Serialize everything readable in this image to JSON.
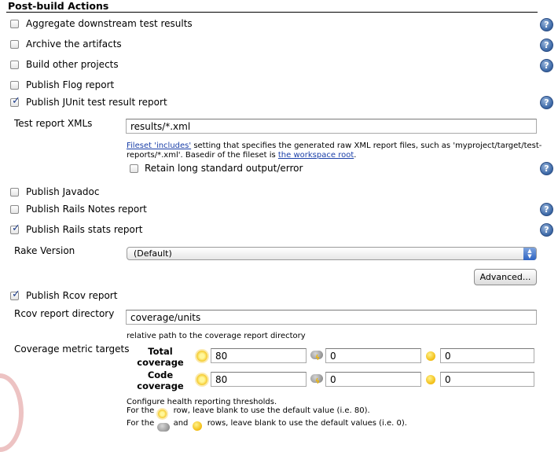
{
  "section": {
    "title": "Post-build Actions"
  },
  "actions": {
    "aggregate": {
      "label": "Aggregate downstream test results",
      "checked": false
    },
    "archive": {
      "label": "Archive the artifacts",
      "checked": false
    },
    "build_other": {
      "label": "Build other projects",
      "checked": false
    },
    "flog": {
      "label": "Publish Flog report",
      "checked": false
    },
    "junit": {
      "label": "Publish JUnit test result report",
      "checked": true
    },
    "javadoc": {
      "label": "Publish Javadoc",
      "checked": false
    },
    "rails_notes": {
      "label": "Publish Rails Notes report",
      "checked": false
    },
    "rails_stats": {
      "label": "Publish Rails stats report",
      "checked": true
    },
    "rcov": {
      "label": "Publish Rcov report",
      "checked": true
    }
  },
  "junit": {
    "xml_label": "Test report XMLs",
    "xml_value": "results/*.xml",
    "fileset_link": "Fileset 'includes'",
    "desc_part1": " setting that specifies the generated raw XML report files, such as 'myproject/target/test-",
    "desc_part2": "reports/*.xml'. Basedir of the fileset is ",
    "workspace_link": "the workspace root",
    "desc_end": ".",
    "retain_label": "Retain long standard output/error",
    "retain_checked": false
  },
  "rails_stats": {
    "rake_label": "Rake Version",
    "rake_value": "(Default)",
    "advanced_button": "Advanced..."
  },
  "rcov": {
    "dir_label": "Rcov report directory",
    "dir_value": "coverage/units",
    "dir_hint": "relative path to the coverage report directory",
    "targets_label": "Coverage metric targets",
    "rows": [
      {
        "header_line1": "Total",
        "header_line2": "coverage",
        "healthy": "80",
        "unstable": "0",
        "failing": "0"
      },
      {
        "header_line1": "Code",
        "header_line2": "coverage",
        "healthy": "80",
        "unstable": "0",
        "failing": "0"
      }
    ],
    "notes": {
      "line1": "Configure health reporting thresholds.",
      "line2_pre": "For the ",
      "line2_post": " row, leave blank to use the default value (i.e. 80).",
      "line3_pre": "For the ",
      "line3_mid": " and ",
      "line3_post": " rows, leave blank to use the default values (i.e. 0)."
    }
  },
  "icons": {
    "help": "help-icon",
    "sunny": "sunny-weather-icon",
    "stormy": "storm-cloud-icon",
    "yellow_ball": "yellow-ball-icon"
  },
  "colors": {
    "link": "#1a3fa8",
    "help_blue": "#3e6aa8",
    "check_blue": "#1f3e8a"
  }
}
